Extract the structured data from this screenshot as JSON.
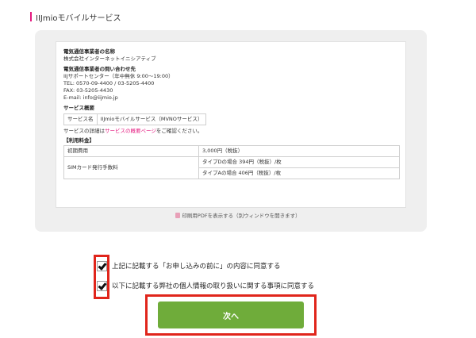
{
  "header": {
    "title": "IIJmioモバイルサービス"
  },
  "doc": {
    "provider_name_title": "電気通信事業者の名称",
    "provider_name": "株式会社インターネットイニシアティブ",
    "contact_title": "電気通信事業者の問い合わせ先",
    "contact_lines": [
      "IIJサポートセンター（年中無休 9:00〜19:00）",
      "TEL: 0570-09-4400 / 03-5205-4400",
      "FAX: 03-5205-4430",
      "E-mail: info@iijmio.jp"
    ],
    "service_title": "サービス概要",
    "service_table": {
      "label": "サービス名",
      "value": "IIJmioモバイルサービス（MVNOサービス）"
    },
    "service_detail_prefix": "サービスの詳細は",
    "service_detail_link": "サービスの概要ページ",
    "service_detail_suffix": "をご確認ください。",
    "fee_title": "【利用料金】",
    "fees": {
      "initial_label": "初期費用",
      "initial_value": "3,000円（税抜）",
      "sim_label": "SIMカード発行手数料",
      "sim_type_d": "タイプDの場合 394円（税抜）/枚",
      "sim_type_a": "タイプAの場合 406円（税抜）/枚"
    },
    "pdf_link": "印刷用PDFを表示する（別ウィンドウを開きます）"
  },
  "agreements": [
    {
      "label": "上記に記載する「お申し込みの前に」の内容に同意する",
      "checked": true
    },
    {
      "label": "以下に記載する弊社の個人情報の取り扱いに関する事項に同意する",
      "checked": true
    }
  ],
  "next_button": {
    "label": "次へ"
  },
  "colors": {
    "accent": "#e4197f",
    "button": "#6fac3a",
    "highlight": "#e0251b"
  }
}
